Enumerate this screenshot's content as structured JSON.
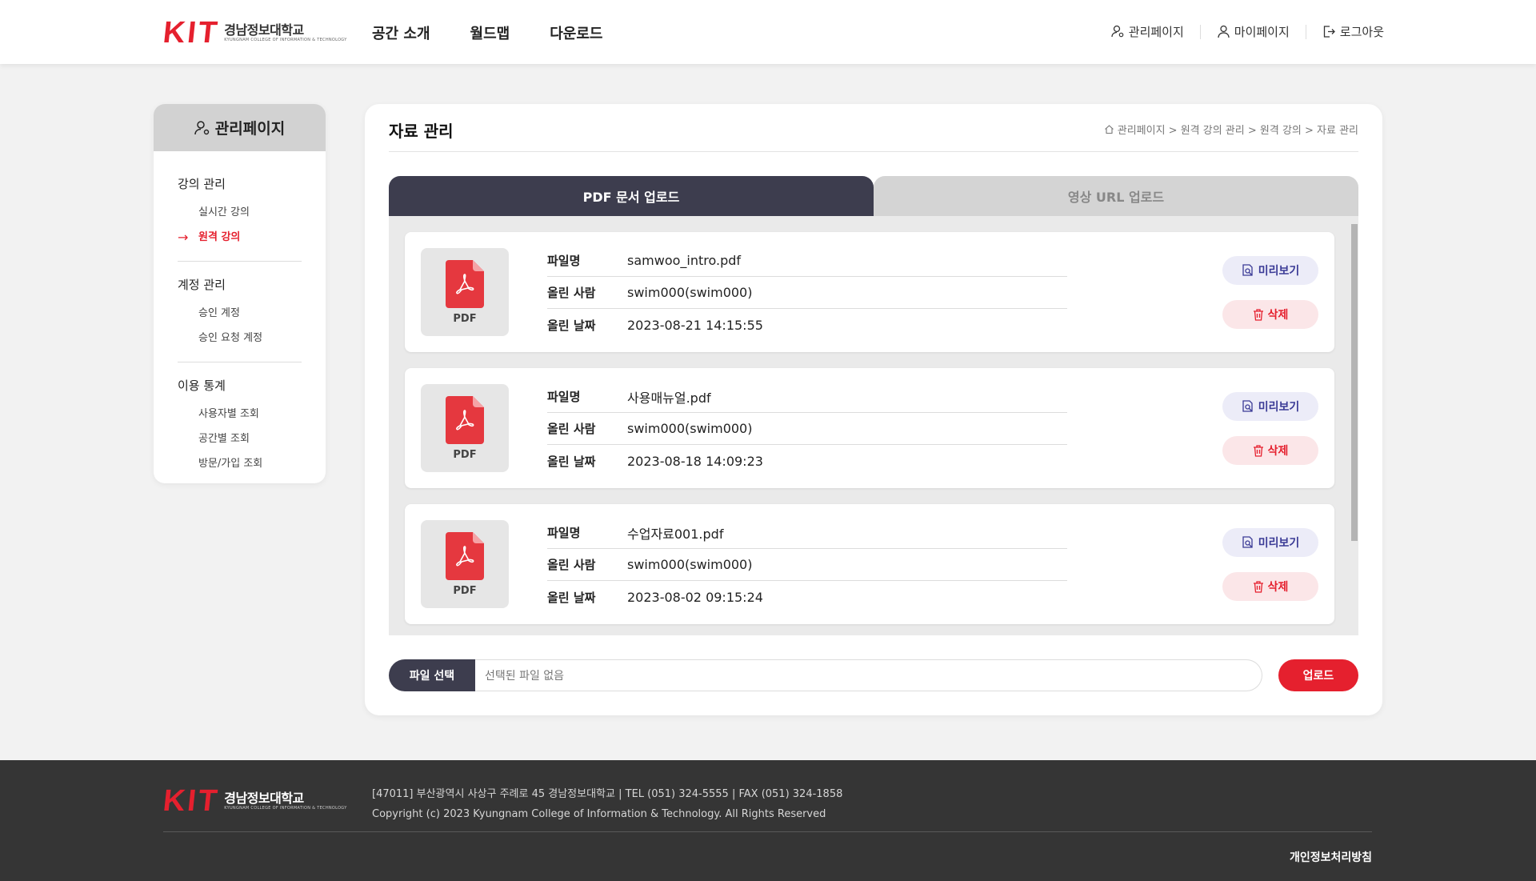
{
  "brand": {
    "logo_text": "KIT",
    "korean_name": "경남정보대학교",
    "english_name": "KYUNGNAM COLLEGE OF INFORMATION & TECHNOLOGY",
    "accent_color": "#e5202e"
  },
  "gnb": [
    "공간 소개",
    "월드맵",
    "다운로드"
  ],
  "util": {
    "admin": "관리페이지",
    "mypage": "마이페이지",
    "logout": "로그아웃"
  },
  "sidebar": {
    "title": "관리페이지",
    "groups": [
      {
        "title": "강의 관리",
        "items": [
          "실시간 강의",
          "원격 강의"
        ]
      },
      {
        "title": "계정 관리",
        "items": [
          "승인 계정",
          "승인 요청 계정"
        ]
      },
      {
        "title": "이용 통계",
        "items": [
          "사용자별 조회",
          "공간별 조회",
          "방문/가입 조회"
        ]
      }
    ],
    "active_item": "원격 강의"
  },
  "main": {
    "title": "자료 관리",
    "breadcrumb": "관리페이지 > 원격 강의 관리 > 원격 강의 > 자료 관리",
    "tabs": [
      "PDF 문서 업로드",
      "영상 URL 업로드"
    ],
    "active_tab": "PDF 문서 업로드",
    "labels": {
      "filename": "파일명",
      "uploader": "올린 사람",
      "date": "올린 날짜",
      "pdf": "PDF"
    },
    "buttons": {
      "preview": "미리보기",
      "delete": "삭제"
    },
    "files": [
      {
        "filename": "samwoo_intro.pdf",
        "uploader": "swim000(swim000)",
        "date": "2023-08-21 14:15:55"
      },
      {
        "filename": "사용매뉴얼.pdf",
        "uploader": "swim000(swim000)",
        "date": "2023-08-18 14:09:23"
      },
      {
        "filename": "수업자료001.pdf",
        "uploader": "swim000(swim000)",
        "date": "2023-08-02 09:15:24"
      }
    ],
    "upload": {
      "choose_label": "파일 선택",
      "placeholder": "선택된 파일 없음",
      "submit_label": "업로드"
    }
  },
  "footer": {
    "address": "[47011] 부산광역시 사상구 주례로 45 경남정보대학교  |  TEL (051) 324-5555  |  FAX (051) 324-1858",
    "copyright": "Copyright (c) 2023 Kyungnam College of Information & Technology. All Rights Reserved",
    "privacy": "개인정보처리방침"
  }
}
